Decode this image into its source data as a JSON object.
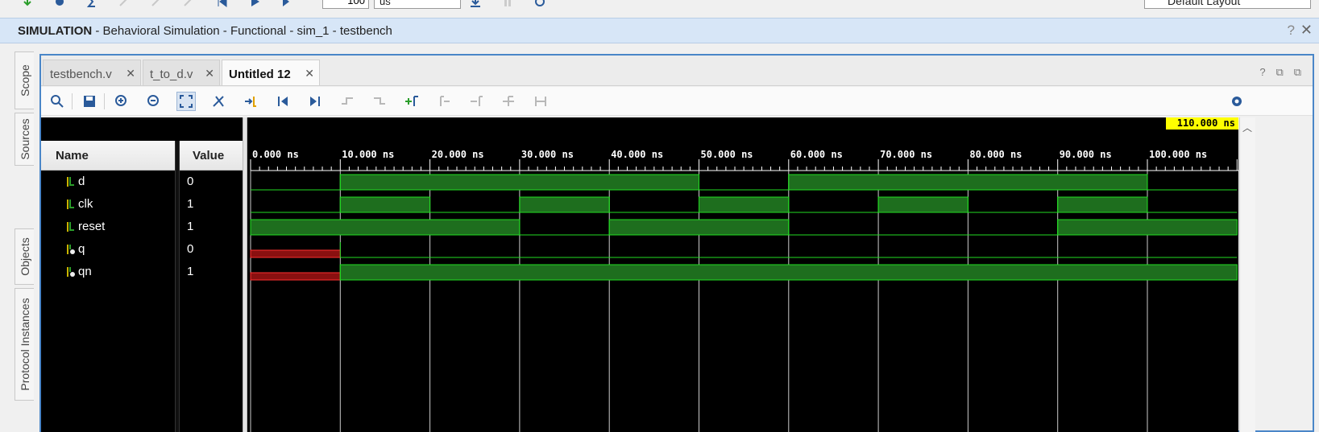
{
  "toolbar": {
    "icons": [
      "restart-icon",
      "settings-icon",
      "sum-icon",
      "disabled-icon",
      "disabled-icon",
      "disabled-icon",
      "step-first-icon",
      "run-icon",
      "run-for-icon"
    ],
    "time_value": "100",
    "time_unit": "us",
    "layout": "Default Layout"
  },
  "header": {
    "mode": "SIMULATION",
    "subtitle": " - Behavioral Simulation - Functional - sim_1 - testbench",
    "help": "?",
    "close": "✕"
  },
  "side_tabs": [
    "Scope",
    "Sources",
    "Objects",
    "Protocol Instances"
  ],
  "file_tabs": [
    {
      "label": "testbench.v",
      "close": "✕"
    },
    {
      "label": "t_to_d.v",
      "close": "✕"
    },
    {
      "label": "Untitled 12",
      "close": "✕"
    }
  ],
  "tab_icons": [
    "?",
    "⧉",
    "⧉",
    "⧉"
  ],
  "columns": {
    "name": "Name",
    "value": "Value"
  },
  "signals": [
    {
      "name": "d",
      "value": "0"
    },
    {
      "name": "clk",
      "value": "1"
    },
    {
      "name": "reset",
      "value": "1"
    },
    {
      "name": "q",
      "value": "0"
    },
    {
      "name": "qn",
      "value": "1"
    }
  ],
  "waveform": {
    "cursor_time": "110.000 ns",
    "time_start_ns": 0,
    "time_end_ns": 110,
    "ticks": [
      "0.000 ns",
      "10.000 ns",
      "20.000 ns",
      "30.000 ns",
      "40.000 ns",
      "50.000 ns",
      "60.000 ns",
      "70.000 ns",
      "80.000 ns",
      "90.000 ns",
      "100.000 ns"
    ],
    "colors": {
      "high": "#1e6e1e",
      "edge": "#22dd22",
      "unknown": "#8a1010",
      "unknown_edge": "#ff3030",
      "cursor": "#ffff00"
    },
    "traces": [
      {
        "name": "d",
        "segments": [
          [
            0,
            10,
            "0"
          ],
          [
            10,
            50,
            "1"
          ],
          [
            50,
            60,
            "0"
          ],
          [
            60,
            100,
            "1"
          ],
          [
            100,
            110,
            "0"
          ]
        ]
      },
      {
        "name": "clk",
        "segments": [
          [
            0,
            10,
            "0"
          ],
          [
            10,
            20,
            "1"
          ],
          [
            20,
            30,
            "0"
          ],
          [
            30,
            40,
            "1"
          ],
          [
            40,
            50,
            "0"
          ],
          [
            50,
            60,
            "1"
          ],
          [
            60,
            70,
            "0"
          ],
          [
            70,
            80,
            "1"
          ],
          [
            80,
            90,
            "0"
          ],
          [
            90,
            100,
            "1"
          ],
          [
            100,
            110,
            "0"
          ]
        ]
      },
      {
        "name": "reset",
        "segments": [
          [
            0,
            30,
            "1"
          ],
          [
            30,
            40,
            "0"
          ],
          [
            40,
            60,
            "1"
          ],
          [
            60,
            90,
            "0"
          ],
          [
            90,
            110,
            "1"
          ]
        ]
      },
      {
        "name": "q",
        "segments": [
          [
            0,
            10,
            "X"
          ],
          [
            10,
            110,
            "0"
          ]
        ]
      },
      {
        "name": "qn",
        "segments": [
          [
            0,
            10,
            "X"
          ],
          [
            10,
            110,
            "1"
          ]
        ]
      }
    ]
  }
}
